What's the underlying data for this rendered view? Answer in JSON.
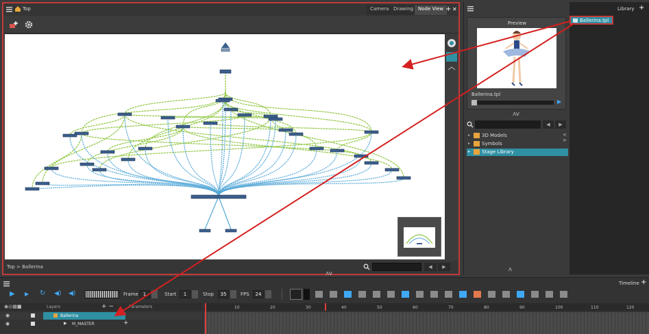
{
  "nodeview": {
    "title": "Top",
    "tabs": [
      "Camera",
      "Drawing",
      "Node View"
    ],
    "breadcrumb": "Top > Ballerina"
  },
  "library": {
    "tab": "Library",
    "preview_label": "Preview",
    "template_name": "Ballerina.tpl",
    "dragged_item": "Ballerina.tpl",
    "tree": [
      "3D Models",
      "Symbols",
      "Stage Library"
    ]
  },
  "timeline": {
    "tab": "Timeline",
    "frame_label": "Frame",
    "frame_value": "1",
    "start_label": "Start",
    "start_value": "1",
    "stop_label": "Stop",
    "stop_value": "35",
    "fps_label": "FPS",
    "fps_value": "24",
    "layers_header": "Layers",
    "parameters_header": "Parameters",
    "layers": [
      "Ballerina",
      "M_MASTER"
    ],
    "ruler": [
      "10",
      "20",
      "30",
      "40",
      "50",
      "60",
      "70",
      "80",
      "90",
      "100",
      "110",
      "120"
    ]
  },
  "colors": {
    "highlight": "#c43a3a",
    "selection": "#2f8fa3",
    "green_link": "#8ec63f",
    "blue_link": "#55a8d8"
  }
}
